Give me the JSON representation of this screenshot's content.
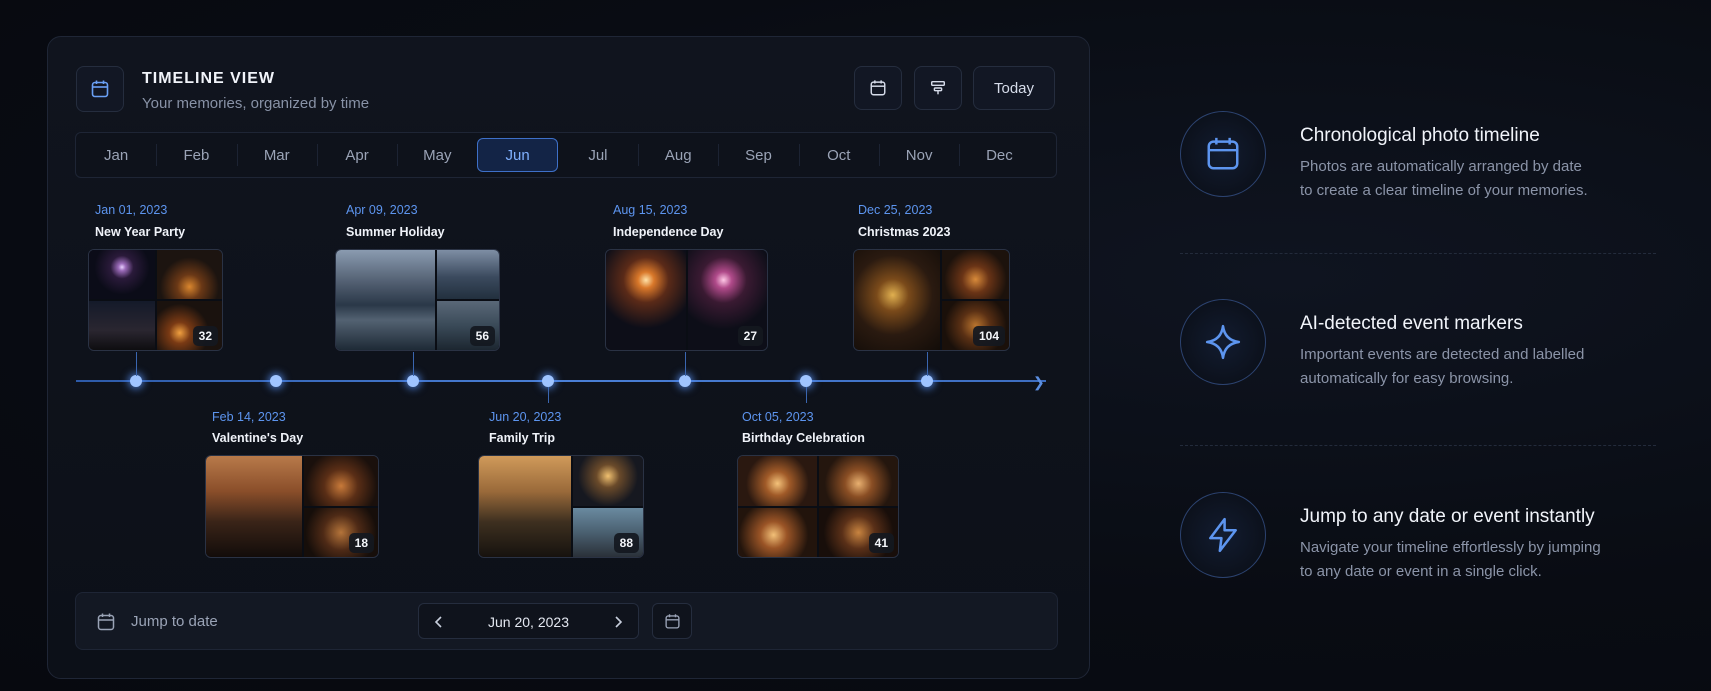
{
  "panel": {
    "title": "TIMELINE VIEW",
    "subtitle": "Your memories, organized by time",
    "today_label": "Today"
  },
  "months": [
    "Jan",
    "Feb",
    "Mar",
    "Apr",
    "May",
    "Jun",
    "Jul",
    "Aug",
    "Sep",
    "Oct",
    "Nov",
    "Dec"
  ],
  "active_month": "Jun",
  "events_top": [
    {
      "date": "Jan 01, 2023",
      "name": "New Year Party",
      "count": "32"
    },
    {
      "date": "Apr 09, 2023",
      "name": "Summer Holiday",
      "count": "56"
    },
    {
      "date": "Aug 15, 2023",
      "name": "Independence Day",
      "count": "27"
    },
    {
      "date": "Dec 25, 2023",
      "name": "Christmas 2023",
      "count": "104"
    }
  ],
  "events_bottom": [
    {
      "date": "Feb 14, 2023",
      "name": "Valentine's Day",
      "count": "18"
    },
    {
      "date": "Jun 20, 2023",
      "name": "Family Trip",
      "count": "88"
    },
    {
      "date": "Oct 05, 2023",
      "name": "Birthday Celebration",
      "count": "41"
    }
  ],
  "footer": {
    "jump_label": "Jump to date",
    "current_date": "Jun 20, 2023"
  },
  "features": [
    {
      "icon": "calendar-icon",
      "title": "Chronological photo timeline",
      "desc_lines": [
        "Photos are automatically arranged by date",
        "to create a clear timeline of your memories."
      ]
    },
    {
      "icon": "sparkle-icon",
      "title": "AI-detected event markers",
      "desc_lines": [
        "Important events are detected and labelled",
        "automatically for easy browsing."
      ]
    },
    {
      "icon": "lightning-icon",
      "title": "Jump to any date or event instantly",
      "desc_lines": [
        "Navigate your timeline effortlessly by jumping",
        "to any date or event in a single click."
      ]
    }
  ],
  "colors": {
    "accent": "#5d95ef",
    "background": "#090c13",
    "panel": "#10141e"
  }
}
